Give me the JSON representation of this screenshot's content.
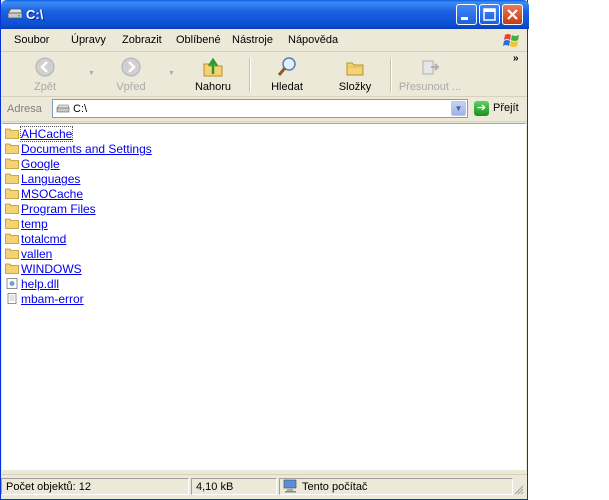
{
  "window": {
    "title": "C:\\"
  },
  "menu": [
    "Soubor",
    "Úpravy",
    "Zobrazit",
    "Oblíbené",
    "Nástroje",
    "Nápověda"
  ],
  "toolbar": {
    "back": "Zpět",
    "forward": "Vpřed",
    "up": "Nahoru",
    "search": "Hledat",
    "folders": "Složky",
    "move": "Přesunout ..."
  },
  "address": {
    "label": "Adresa",
    "value": "C:\\",
    "go": "Přejít"
  },
  "files": [
    {
      "name": "AHCache",
      "type": "folder"
    },
    {
      "name": "Documents and Settings",
      "type": "folder"
    },
    {
      "name": "Google",
      "type": "folder"
    },
    {
      "name": "Languages",
      "type": "folder"
    },
    {
      "name": "MSOCache",
      "type": "folder"
    },
    {
      "name": "Program Files",
      "type": "folder"
    },
    {
      "name": "temp",
      "type": "folder"
    },
    {
      "name": "totalcmd",
      "type": "folder"
    },
    {
      "name": "vallen",
      "type": "folder"
    },
    {
      "name": "WINDOWS",
      "type": "folder"
    },
    {
      "name": "help.dll",
      "type": "dll"
    },
    {
      "name": "mbam-error",
      "type": "text"
    }
  ],
  "status": {
    "count": "Počet objektů: 12",
    "size": "4,10 kB",
    "location": "Tento počítač"
  },
  "colors": {
    "titlebar": "#0a4fd1",
    "chrome": "#ECE9D8",
    "link": "#0000ee",
    "folder": "#f4d374"
  }
}
